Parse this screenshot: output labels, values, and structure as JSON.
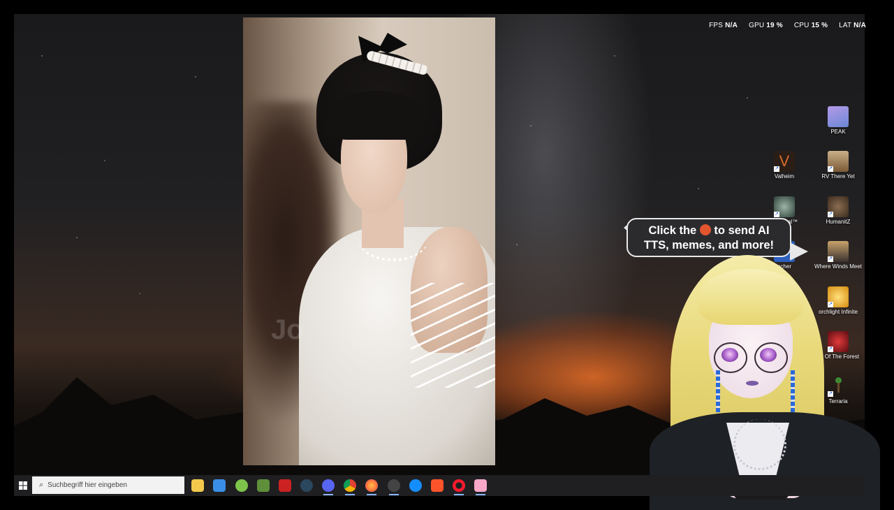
{
  "stats": {
    "fps_label": "FPS",
    "fps_value": "N/A",
    "gpu_label": "GPU",
    "gpu_value": "19 %",
    "cpu_label": "CPU",
    "cpu_value": "15 %",
    "lat_label": "LAT",
    "lat_value": "N/A"
  },
  "video": {
    "watermark": "Jo"
  },
  "desktop_icons": [
    {
      "label": "PEAK",
      "icon": "peak-icon",
      "color": "#7b8fd8"
    },
    {
      "label": "Valheim",
      "icon": "valheim-icon",
      "color": "#3b2a1f"
    },
    {
      "label": "RV There Yet",
      "icon": "rv-there-yet-icon",
      "color": "#8a6a3f"
    },
    {
      "label": "Returnal™",
      "icon": "returnal-icon",
      "color": "#3d5a4d"
    },
    {
      "label": "HumanitZ",
      "icon": "humanitz-icon",
      "color": "#5a4634"
    },
    {
      "label": "echer",
      "icon": "launcher-icon",
      "color": "#2d5fbf"
    },
    {
      "label": "Where Winds Meet",
      "icon": "where-winds-meet-icon",
      "color": "#3a3130"
    },
    {
      "label": "orchlight Infinite",
      "icon": "torchlight-infinite-icon",
      "color": "#e0a21c"
    },
    {
      "label": "ns Of The Forest",
      "icon": "sons-of-the-forest-icon",
      "color": "#b01f2a"
    },
    {
      "label": "Terraria",
      "icon": "terraria-icon",
      "color": "#3e8a34"
    }
  ],
  "overlay": {
    "bubble_line1_pre": "Click the",
    "bubble_line1_post": "to send AI",
    "bubble_line2": "TTS, memes, and more!"
  },
  "taskbar": {
    "search_placeholder": "Suchbegriff hier eingeben",
    "apps": [
      {
        "name": "file-explorer-icon",
        "color": "#f2c94c"
      },
      {
        "name": "microsoft-store-icon",
        "color": "#3a8ee6"
      },
      {
        "name": "android-app-icon",
        "color": "#7ec34a"
      },
      {
        "name": "minecraft-icon",
        "color": "#5f8f3a"
      },
      {
        "name": "news-app-icon",
        "color": "#c22"
      },
      {
        "name": "steam-icon",
        "color": "#1b2838"
      },
      {
        "name": "discord-icon",
        "color": "#5865f2"
      },
      {
        "name": "chrome-icon",
        "color": "#e34133"
      },
      {
        "name": "firefox-icon",
        "color": "#ff7139"
      },
      {
        "name": "obs-icon",
        "color": "#444"
      },
      {
        "name": "battle-net-icon",
        "color": "#148eff"
      },
      {
        "name": "brave-icon",
        "color": "#fb542b"
      },
      {
        "name": "opera-icon",
        "color": "#ff1b2d"
      },
      {
        "name": "pink-app-icon",
        "color": "#f7a8c8"
      }
    ]
  }
}
